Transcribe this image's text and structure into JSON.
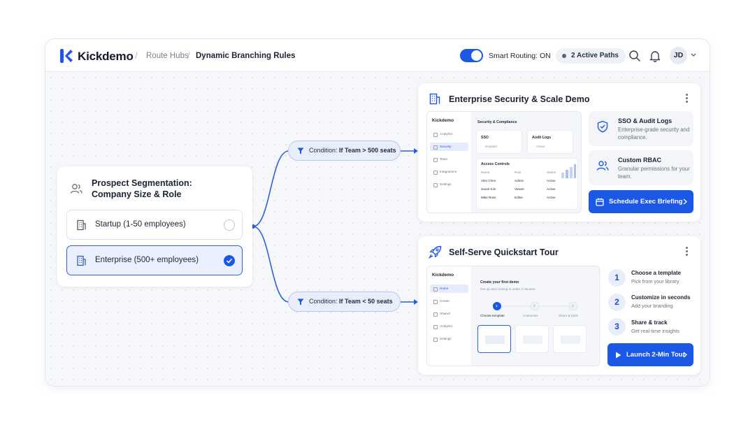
{
  "colors": {
    "accent": "#1c58e6",
    "connector": "#2b5fe0",
    "selected_bg": "#eaf0fd"
  },
  "header": {
    "brand": "Kickdemo",
    "breadcrumb": [
      "Route Hubs",
      "Dynamic Branching Rules"
    ],
    "smart_routing": {
      "label": "Smart Routing: ON",
      "on": true
    },
    "active_paths": "2 Active Paths",
    "avatar_initials": "JD",
    "icons": [
      "search-icon",
      "bell-icon",
      "chevron-down-icon"
    ]
  },
  "segmentation": {
    "title": "Prospect Segmentation: Company Size & Role",
    "options": [
      {
        "label": "Startup (1-50 employees)",
        "selected": false
      },
      {
        "label": "Enterprise (500+ employees)",
        "selected": true
      }
    ]
  },
  "conditions": [
    {
      "prefix": "Condition:",
      "text": "If Team > 500 seats"
    },
    {
      "prefix": "Condition:",
      "text": "If Team < 50 seats"
    }
  ],
  "enterprise_demo": {
    "title": "Enterprise Security & Scale Demo",
    "preview": {
      "brand": "Kickdemo",
      "nav": [
        "Analytics",
        "Security",
        "Team",
        "Integrations",
        "Settings"
      ],
      "active_nav": "Security",
      "heading": "Security & Compliance",
      "cards": [
        {
          "title": "SSO",
          "status": "Enabled"
        },
        {
          "title": "Audit Logs",
          "status": "Active"
        }
      ],
      "table_title": "Access Controls",
      "columns": [
        "Name",
        "Role",
        "Status"
      ],
      "rows": [
        [
          "Alex Chen",
          "Admin",
          "Active"
        ],
        [
          "Sarah Kim",
          "Viewer",
          "Active"
        ],
        [
          "Mike Ross",
          "Editor",
          "Active"
        ]
      ]
    },
    "features": [
      {
        "title": "SSO & Audit Logs",
        "subtitle": "Enterprise-grade security and compliance."
      },
      {
        "title": "Custom RBAC",
        "subtitle": "Granular permissions for your team."
      }
    ],
    "cta": "Schedule Exec Briefing"
  },
  "selfserve_demo": {
    "title": "Self-Serve Quickstart Tour",
    "preview": {
      "brand": "Kickdemo",
      "nav": [
        "Home",
        "Create",
        "Shared",
        "Analytics",
        "Settings"
      ],
      "active_nav": "Home",
      "heading": "Create your first demo",
      "subheading": "Get up and running in under 2 minutes.",
      "steps": [
        {
          "n": "1",
          "label": "Choose template"
        },
        {
          "n": "2",
          "label": "Customize"
        },
        {
          "n": "3",
          "label": "Share & track"
        }
      ]
    },
    "steps": [
      {
        "n": "1",
        "title": "Choose a template",
        "subtitle": "Pick from your library"
      },
      {
        "n": "2",
        "title": "Customize in seconds",
        "subtitle": "Add your branding"
      },
      {
        "n": "3",
        "title": "Share & track",
        "subtitle": "Get real-time insights"
      }
    ],
    "cta": "Launch 2-Min Tour"
  }
}
